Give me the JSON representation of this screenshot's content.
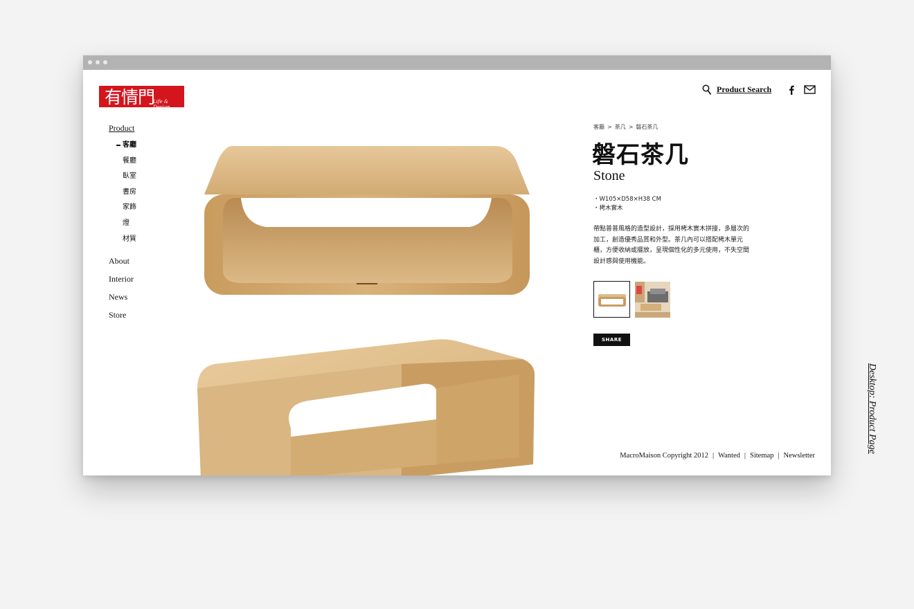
{
  "brand": {
    "name": "有情門",
    "tagline": "Life & Design"
  },
  "header": {
    "search_label": "Product Search",
    "icons": [
      "search-icon",
      "facebook-icon",
      "mail-icon"
    ]
  },
  "sidebar": {
    "product_label": "Product",
    "categories": [
      {
        "label": "客廳",
        "active": true
      },
      {
        "label": "餐廳"
      },
      {
        "label": "臥室"
      },
      {
        "label": "書房"
      },
      {
        "label": "家飾"
      },
      {
        "label": "燈"
      },
      {
        "label": "材質"
      }
    ],
    "main_links": [
      "About",
      "Interior",
      "News",
      "Store"
    ]
  },
  "product": {
    "breadcrumb": [
      "客廳",
      ">",
      "茶几",
      ">",
      "磐石茶几"
    ],
    "title_zh": "磐石茶几",
    "title_en": "Stone",
    "specs": [
      "・W105×D58×H38 CM",
      "・栲木實木"
    ],
    "description": "帶點普普風格的造型設計，採用栲木實木拼接，多層次的加工，創造優秀品質和外型。茶几內可以搭配栲木單元櫃，方便收納或擺放，呈現個性化的多元使用，不失空間設計感與使用機能。",
    "share_label": "SHARE"
  },
  "footer": {
    "copyright": "MacroMaison Copyright 2012",
    "links": [
      "Wanted",
      "Sitemap",
      "Newsletter"
    ],
    "separator": "|"
  },
  "caption": "Desktop: Product Page",
  "colors": {
    "brand_red": "#d4151d",
    "wood": "#d6b27c",
    "titlebar": "#b3b3b3"
  }
}
